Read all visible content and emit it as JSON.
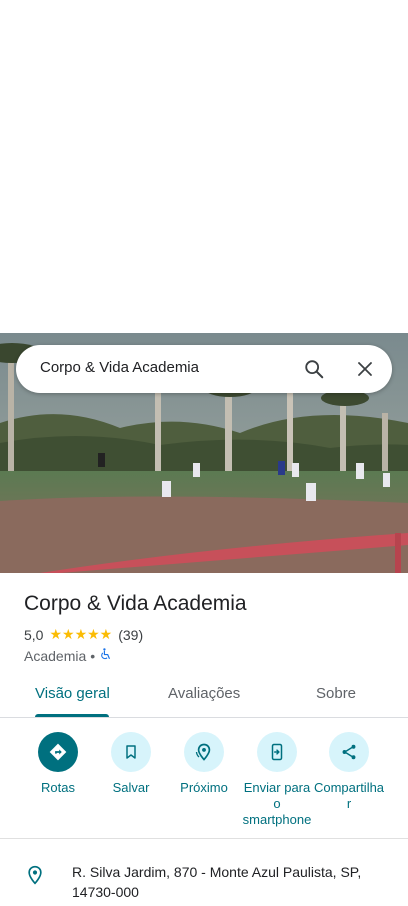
{
  "search": {
    "query": "Corpo & Vida Academia"
  },
  "place": {
    "name": "Corpo & Vida Academia",
    "rating": "5,0",
    "rating_value": 5.0,
    "stars": "★★★★★",
    "review_count": "(39)",
    "category": "Academia",
    "separator": "•"
  },
  "tabs": [
    {
      "label": "Visão geral",
      "active": true
    },
    {
      "label": "Avaliações",
      "active": false
    },
    {
      "label": "Sobre",
      "active": false
    }
  ],
  "actions": [
    {
      "label": "Rotas",
      "icon": "directions-icon"
    },
    {
      "label": "Salvar",
      "icon": "bookmark-icon"
    },
    {
      "label": "Próximo",
      "icon": "nearby-icon"
    },
    {
      "label": "Enviar para o smartphone",
      "icon": "send-to-phone-icon"
    },
    {
      "label": "Compartilhar",
      "icon": "share-icon"
    }
  ],
  "address": {
    "text": "R. Silva Jardim, 870 - Monte Azul Paulista, SP, 14730-000"
  },
  "colors": {
    "accent": "#00707f",
    "action_bg": "#d7f4fb",
    "star": "#fbbc04"
  }
}
